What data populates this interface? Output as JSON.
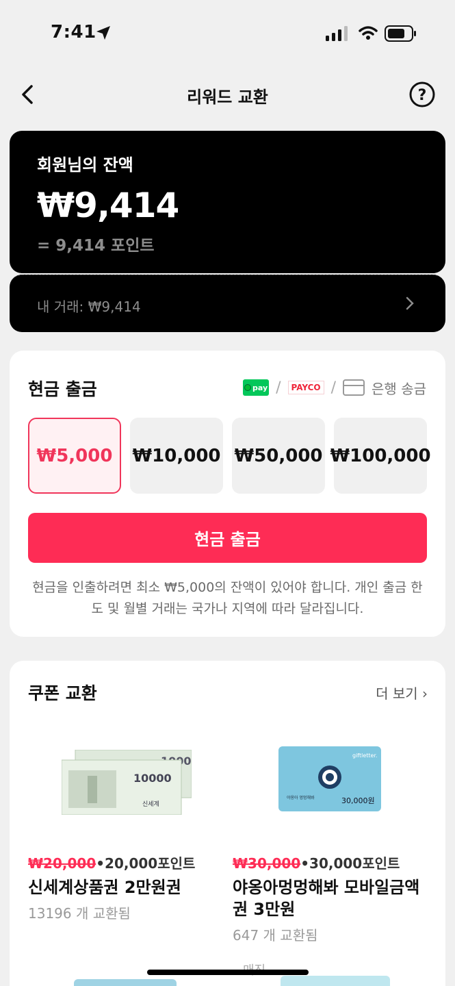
{
  "status_bar": {
    "time": "7:41"
  },
  "header": {
    "title": "리워드 교환"
  },
  "balance": {
    "label": "회원님의 잔액",
    "amount": "₩9,414",
    "points": "= 9,414 포인트",
    "transactions": "내 거래: ₩9,414"
  },
  "cash": {
    "title": "현금 출금",
    "methods": {
      "npay_label": "pay",
      "payco_label": "PAYCO",
      "bank_label": "은행 송금"
    },
    "options": [
      "₩5,000",
      "₩10,000",
      "₩50,000",
      "₩100,000"
    ],
    "selected_option": "₩5,000",
    "button_label": "현금 출금",
    "note": "현금을 인출하려면 최소 ₩5,000의 잔액이 있어야 합니다. 개인 출금 한도 및 월별 거래는 국가나 지역에 따라 달라집니다."
  },
  "coupons": {
    "title": "쿠폰 교환",
    "more_label": "더 보기 ›",
    "items": [
      {
        "original_price": "₩20,000",
        "points": "•20,000포인트",
        "name": "신세계상품권 2만원권",
        "exchanged": "13196 개 교환됨",
        "image_text": "10000"
      },
      {
        "original_price": "₩30,000",
        "points": "•30,000포인트",
        "name": "야옹아멍멍해봐 모바일금액권 3만원",
        "exchanged": "647 개 교환됨",
        "image_brand": "giftletter.",
        "image_value": "30,000원"
      }
    ],
    "peek_label": "매진"
  },
  "colors": {
    "accent": "#fe2c55",
    "card_dark": "#000000",
    "npay_green": "#03c75a"
  }
}
